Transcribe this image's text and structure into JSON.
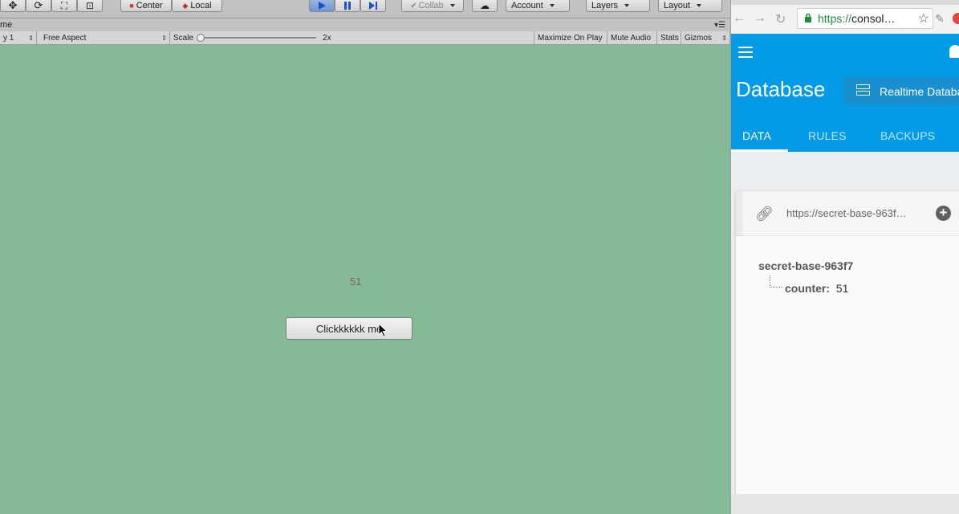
{
  "unity": {
    "toolbar": {
      "pivot_label": "Center",
      "space_label": "Local",
      "collab_label": "Collab",
      "account_label": "Account",
      "layers_label": "Layers",
      "layout_label": "Layout"
    },
    "game_tab": {
      "title": "me"
    },
    "game_controls": {
      "display_label": "y 1",
      "aspect_label": "Free Aspect",
      "scale_label": "Scale",
      "scale_value": "2x",
      "maximize_label": "Maximize On Play",
      "mute_label": "Mute Audio",
      "stats_label": "Stats",
      "gizmos_label": "Gizmos"
    },
    "game_view": {
      "counter_text": "51",
      "button_label": "Clickkkkkk me",
      "background_color": "#84ba96"
    }
  },
  "browser": {
    "url": "https://consol…",
    "url_scheme": "https://",
    "url_host": "consol…"
  },
  "firebase": {
    "page_title": "Database",
    "product_selector": "Realtime Databa",
    "tabs": [
      {
        "label": "DATA"
      },
      {
        "label": "RULES"
      },
      {
        "label": "BACKUPS"
      }
    ],
    "db_url": "https://secret-base-963f…",
    "tree": {
      "root": "secret-base-963f7",
      "child_key": "counter:",
      "child_value": "51"
    },
    "accent_color": "#039be5"
  }
}
